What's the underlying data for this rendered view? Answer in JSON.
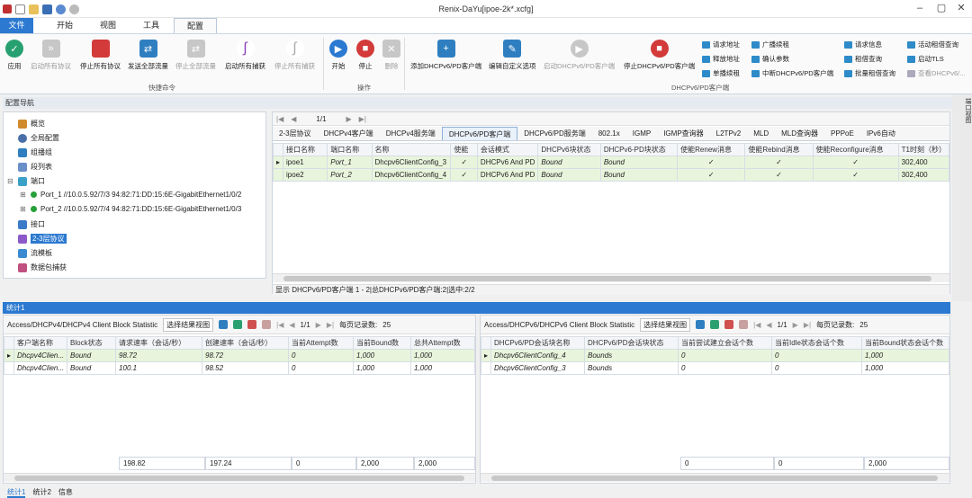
{
  "window": {
    "title": "Renix-DaYu[ipoe-2k*.xcfg]"
  },
  "ribbon_tabs": [
    "文件",
    "开始",
    "视图",
    "工具",
    "配置"
  ],
  "ribbon": {
    "quick": [
      "应用",
      "启动所有协议",
      "停止所有协议",
      "发送全部流量",
      "停止全部流量",
      "启动所有捕获",
      "停止所有捕获"
    ],
    "quick_group": "快捷命令",
    "ops": [
      "开始",
      "停止",
      "删除"
    ],
    "ops_group": "操作",
    "dhcp": [
      "添加DHCPv6/PD客户端",
      "编辑自定义选项",
      "启动DHCPv6/PD客户端",
      "停止DHCPv6/PD客户端"
    ],
    "dhcp_group": "DHCPv6/PD客户端",
    "small1": [
      "请求地址",
      "释放地址",
      "单播续租"
    ],
    "small2": [
      "广播续租",
      "确认参数",
      "中断DHCPv6/PD客户端"
    ],
    "small3": [
      "请求信息",
      "租借查询",
      "批量租借查询"
    ],
    "small4": [
      "活动租借查询",
      "启动TLS",
      "查看DHCPv6/..."
    ]
  },
  "nav": {
    "header": "配置导航",
    "items": [
      "概览",
      "全局配置",
      "组播组",
      "段列表",
      "端口",
      "Port_1 //10.0.5.92/7/3 94:82:71:DD:15:6E-GigabitEthernet1/0/2",
      "Port_2 //10.0.5.92/7/4 94:82:71:DD:15:6E-GigabitEthernet1/0/3",
      "接口",
      "2-3层协议",
      "流模板",
      "数据包捕获"
    ]
  },
  "main": {
    "page": "1/1",
    "tabs": [
      "2-3层协议",
      "DHCPv4客户端",
      "DHCPv4服务端",
      "DHCPv6/PD客户端",
      "DHCPv6/PD服务端",
      "802.1x",
      "IGMP",
      "IGMP查询器",
      "L2TPv2",
      "MLD",
      "MLD查询器",
      "PPPoE",
      "IPv6自动"
    ],
    "columns": [
      "接口名称",
      "端口名称",
      "名称",
      "使能",
      "会话模式",
      "DHCPv6块状态",
      "DHCPv6-PD块状态",
      "使能Renew消息",
      "使能Rebind消息",
      "使能Reconfigure消息",
      "T1时刻（秒）"
    ],
    "rows": [
      [
        "ipoe1",
        "Port_1",
        "Dhcpv6ClientConfig_3",
        "✓",
        "DHCPv6 And PD",
        "Bound",
        "Bound",
        "✓",
        "✓",
        "✓",
        "302,400"
      ],
      [
        "ipoe2",
        "Port_2",
        "Dhcpv6ClientConfig_4",
        "✓",
        "DHCPv6 And PD",
        "Bound",
        "Bound",
        "✓",
        "✓",
        "✓",
        "302,400"
      ]
    ],
    "status": "显示 DHCPv6/PD客户端 1 - 2|总DHCPv6/PD客户端:2|选中:2/2"
  },
  "stats": {
    "title": "统计1",
    "left": {
      "name": "Access/DHCPv4/DHCPv4 Client Block Statistic",
      "view": "选择结果视图",
      "page": "1/1",
      "per_page_label": "每页记录数:",
      "per_page": "25",
      "columns": [
        "客户端名称",
        "Block状态",
        "请求速率（会话/秒）",
        "创建速率（会话/秒）",
        "当前Attempt数",
        "当前Bound数",
        "总共Attempt数"
      ],
      "rows": [
        [
          "Dhcpv4Clien...",
          "Bound",
          "98.72",
          "98.72",
          "0",
          "1,000",
          "1,000"
        ],
        [
          "Dhcpv4Clien...",
          "Bound",
          "100.1",
          "98.52",
          "0",
          "1,000",
          "1,000"
        ]
      ],
      "totals": [
        "198.82",
        "197.24",
        "0",
        "2,000",
        "2,000"
      ]
    },
    "right": {
      "name": "Access/DHCPv6/DHCPv6 Client Block Statistic",
      "view": "选择结果视图",
      "page": "1/1",
      "per_page_label": "每页记录数:",
      "per_page": "25",
      "columns": [
        "DHCPv6/PD会话块名称",
        "DHCPv6/PD会话块状态",
        "当前尝试建立会话个数",
        "当前Idle状态会话个数",
        "当前Bound状态会话个数"
      ],
      "rows": [
        [
          "Dhcpv6ClientConfig_4",
          "Bounds",
          "0",
          "0",
          "1,000"
        ],
        [
          "Dhcpv6ClientConfig_3",
          "Bounds",
          "0",
          "0",
          "1,000"
        ]
      ],
      "totals": [
        "0",
        "0",
        "2,000"
      ]
    }
  },
  "bottom_tabs": [
    "统计1",
    "统计2",
    "信息"
  ],
  "side_label": "端口视图"
}
